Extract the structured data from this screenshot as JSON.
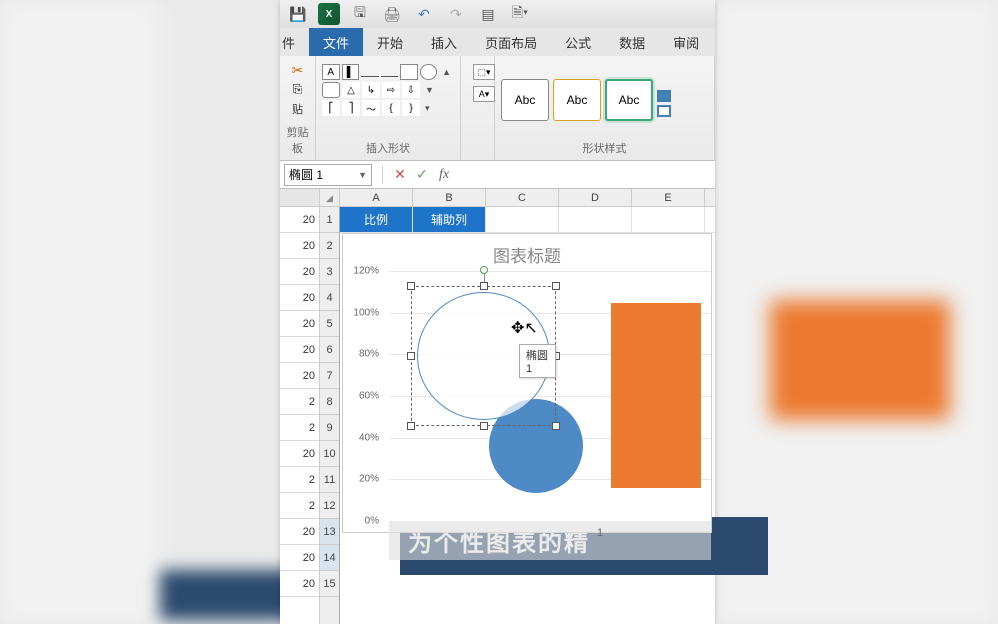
{
  "qat": {
    "excel_label": "X"
  },
  "ribbon": {
    "tabs": [
      "文件",
      "开始",
      "插入",
      "页面布局",
      "公式",
      "数据",
      "审阅"
    ],
    "partial_tab": "件",
    "groups": {
      "clipboard": {
        "label": "剪贴板",
        "paste": "贴"
      },
      "insert_shape": {
        "label": "插入形状"
      },
      "shape_style": {
        "label": "形状样式",
        "abc": "Abc"
      }
    }
  },
  "formula_bar": {
    "name_box": "椭圆 1",
    "fx": "fx",
    "value": ""
  },
  "columns": [
    "A",
    "B",
    "C",
    "D",
    "E"
  ],
  "header_row": {
    "A": "比例",
    "B": "辅助列"
  },
  "row_numbers": [
    "1",
    "2",
    "3",
    "4",
    "5",
    "6",
    "7",
    "8",
    "9",
    "10",
    "11",
    "12",
    "13",
    "14",
    "15"
  ],
  "partial_cells": [
    "20",
    "20",
    "20",
    "20",
    "20",
    "20",
    "20",
    "2",
    "2",
    "20",
    "2",
    "2",
    "20",
    "20",
    "20"
  ],
  "chart_data": {
    "type": "bar",
    "title": "图表标题",
    "categories": [
      "1"
    ],
    "series": [
      {
        "name": "比例",
        "values": [
          0.58
        ],
        "color": "#4e8ac5",
        "marker": "circle"
      },
      {
        "name": "辅助列",
        "values": [
          1.0
        ],
        "color": "#ec7a30"
      }
    ],
    "ylabel": "",
    "ylim": [
      0,
      1.2
    ],
    "y_ticks": [
      "0%",
      "20%",
      "40%",
      "60%",
      "80%",
      "100%",
      "120%"
    ],
    "x_label": "1"
  },
  "shape": {
    "tooltip": "椭圆 1"
  },
  "dark_band_text": "为个性图表的精"
}
